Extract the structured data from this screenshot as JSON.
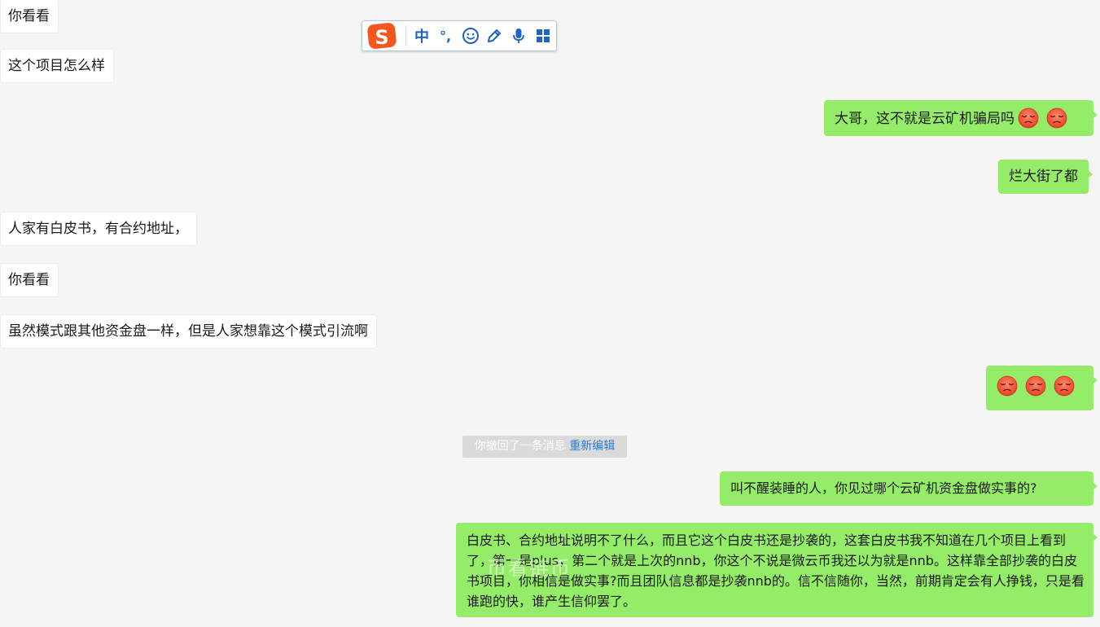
{
  "messages": {
    "m1": "你看看",
    "m2": "这个项目怎么样",
    "m3": "大哥，这不就是云矿机骗局吗",
    "m4": "烂大街了都",
    "m5": "人家有白皮书，有合约地址，",
    "m6": "你看看",
    "m7": "虽然模式跟其他资金盘一样，但是人家想靠这个模式引流啊",
    "m9": "叫不醒装睡的人，你见过哪个云矿机资金盘做实事的?",
    "m10": "白皮书、合约地址说明不了什么，而且它这个白皮书还是抄袭的，这套白皮书我不知道在几个项目上看到了，第一是plus，第二个就是上次的nnb，你这个不说是微云币我还以为就是nnb。这样靠全部抄袭的白皮书项目，你相信是做实事?而且团队信息都是抄袭nnb的。信不信随你，当然，前期肯定会有人挣钱，只是看谁跑的快，谁产生信仰罢了。"
  },
  "emoji_icon": "sad-face-emoji",
  "recall": {
    "text": "你撤回了一条消息",
    "link": "重新编辑"
  },
  "ime_toolbar": {
    "logo_letter": "S",
    "mode_label": "中",
    "punct_label": "°,"
  },
  "watermark": "币看链币"
}
